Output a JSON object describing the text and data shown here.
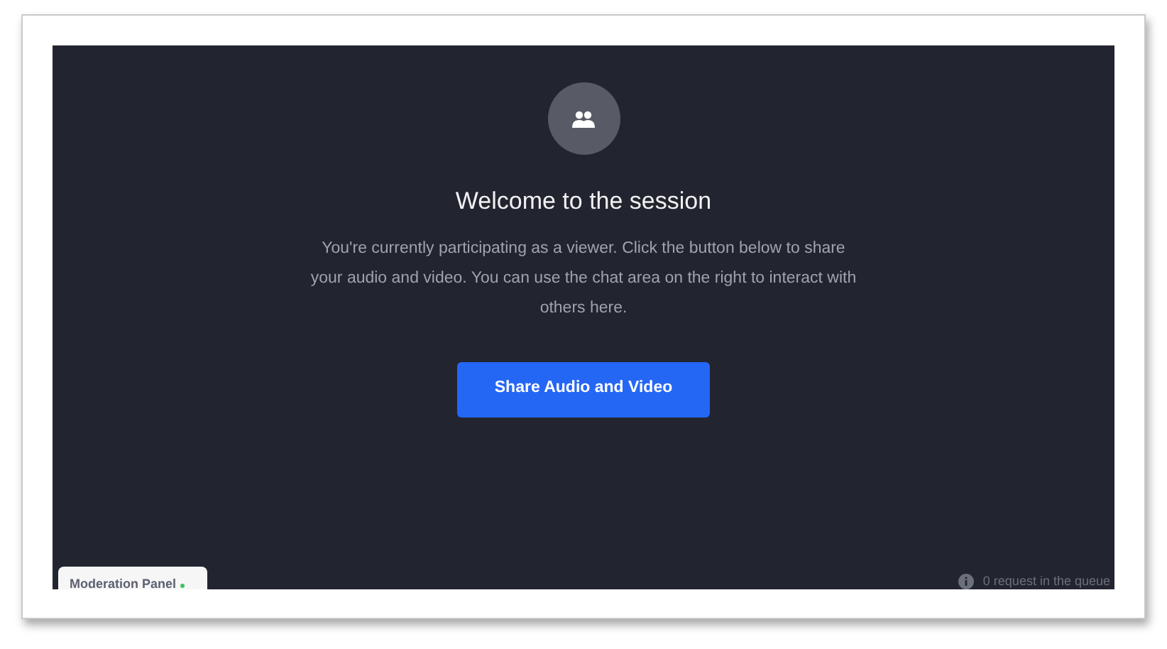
{
  "session": {
    "title": "Welcome to the session",
    "message": "You're currently participating as a viewer. Click the button below to share your audio and video. You can use the chat area on the right to interact with others here.",
    "button": "Share Audio and Video"
  },
  "moderation_panel": {
    "label": "Moderation Panel",
    "online": true
  },
  "queue_status": "0 request in the queue"
}
